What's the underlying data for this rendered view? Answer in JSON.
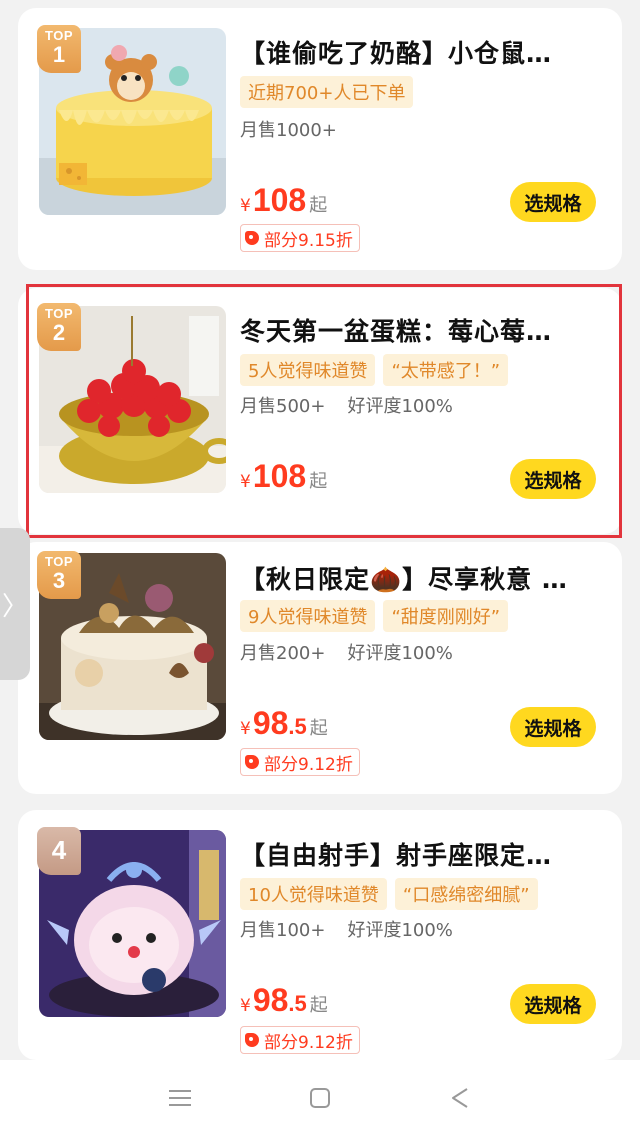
{
  "products": [
    {
      "rank_top": "TOP",
      "rank": "1",
      "title": "【谁偷吃了奶酪】小仓鼠…",
      "tags": [
        "近期700+人已下单"
      ],
      "stats": [
        "月售1000+"
      ],
      "currency": "¥",
      "price_main": "108",
      "price_decimal": "",
      "price_suffix": "起",
      "discount": "部分9.15折",
      "button": "选规格"
    },
    {
      "rank_top": "TOP",
      "rank": "2",
      "title": "冬天第一盆蛋糕：莓心莓…",
      "tags": [
        "5人觉得味道赞",
        "“太带感了！”"
      ],
      "stats": [
        "月售500+",
        "好评度100%"
      ],
      "currency": "¥",
      "price_main": "108",
      "price_decimal": "",
      "price_suffix": "起",
      "discount": "",
      "button": "选规格"
    },
    {
      "rank_top": "TOP",
      "rank": "3",
      "title": "【秋日限定🌰】尽享秋意 …",
      "tags": [
        "9人觉得味道赞",
        "“甜度刚刚好”"
      ],
      "stats": [
        "月售200+",
        "好评度100%"
      ],
      "currency": "¥",
      "price_main": "98",
      "price_decimal": ".5",
      "price_suffix": "起",
      "discount": "部分9.12折",
      "button": "选规格"
    },
    {
      "rank_top": "",
      "rank": "4",
      "title": "【自由射手】射手座限定…",
      "tags": [
        "10人觉得味道赞",
        "“口感绵密细腻”"
      ],
      "stats": [
        "月售100+",
        "好评度100%"
      ],
      "currency": "¥",
      "price_main": "98",
      "price_decimal": ".5",
      "price_suffix": "起",
      "discount": "部分9.12折",
      "button": "选规格"
    }
  ],
  "side_tab": {
    "icon": "chevron-right-icon",
    "glyph": "〉"
  },
  "navbar": {
    "icons": [
      "menu-icon",
      "home-square-icon",
      "back-icon"
    ]
  },
  "colors": {
    "accent_yellow": "#ffd81f",
    "price_red": "#ff3b1f",
    "tag_orange": "#e0882a",
    "highlight_red": "#e2343c"
  }
}
